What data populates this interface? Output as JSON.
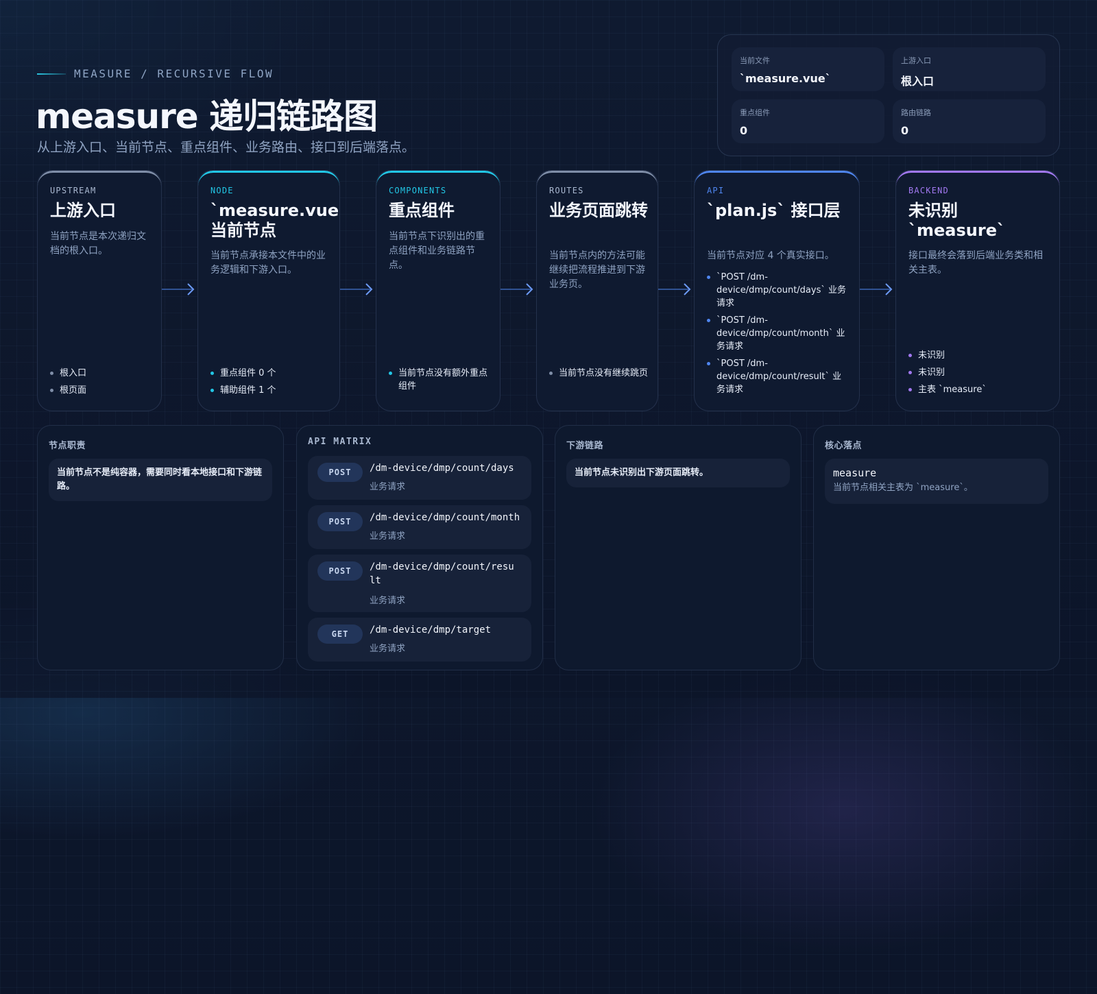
{
  "header": {
    "eyebrow": "MEASURE / RECURSIVE FLOW",
    "title": "measure 递归链路图",
    "subtitle": "从上游入口、当前节点、重点组件、业务路由、接口到后端落点。"
  },
  "stats": [
    {
      "label": "当前文件",
      "value": "`measure.vue`"
    },
    {
      "label": "上游入口",
      "value": "根入口"
    },
    {
      "label": "重点组件",
      "value": "0"
    },
    {
      "label": "路由链路",
      "value": "0"
    }
  ],
  "flow": [
    {
      "kicker": "UPSTREAM",
      "title": "上游入口",
      "desc": "当前节点是本次递归文档的根入口。",
      "items": [
        "根入口",
        "根页面"
      ],
      "color": "#7f8ea8"
    },
    {
      "kicker": "NODE",
      "title": "`measure.vue` 当前节点",
      "desc": "当前节点承接本文件中的业务逻辑和下游入口。",
      "items": [
        "重点组件 0 个",
        "辅助组件 1 个"
      ],
      "color": "#22c7e6"
    },
    {
      "kicker": "COMPONENTS",
      "title": "重点组件",
      "desc": "当前节点下识别出的重点组件和业务链路节点。",
      "items": [
        "当前节点没有额外重点组件"
      ],
      "color": "#22c7e6"
    },
    {
      "kicker": "ROUTES",
      "title": "业务页面跳转",
      "desc": "当前节点内的方法可能继续把流程推进到下游业务页。",
      "items": [
        "当前节点没有继续跳页"
      ],
      "color": "#7f8ea8"
    },
    {
      "kicker": "API",
      "title": "`plan.js` 接口层",
      "desc": "当前节点对应 4 个真实接口。",
      "items": [
        "`POST /dm-device/dmp/count/days` 业务请求",
        "`POST /dm-device/dmp/count/month` 业务请求",
        "`POST /dm-device/dmp/count/result` 业务请求"
      ],
      "color": "#4f86f0"
    },
    {
      "kicker": "BACKEND",
      "title": "未识别 `measure`",
      "desc": "接口最终会落到后端业务类和相关主表。",
      "items": [
        "未识别",
        "未识别",
        "主表 `measure`"
      ],
      "color": "#a178f0"
    }
  ],
  "panels": {
    "duty": {
      "title": "节点职责",
      "note": "当前节点不是纯容器，需要同时看本地接口和下游链路。"
    },
    "api": {
      "title": "API MATRIX",
      "rows": [
        {
          "method": "POST",
          "path": "/dm-device/dmp/count/days",
          "desc": "业务请求"
        },
        {
          "method": "POST",
          "path": "/dm-device/dmp/count/month",
          "desc": "业务请求"
        },
        {
          "method": "POST",
          "path": "/dm-device/dmp/count/result",
          "desc": "业务请求"
        },
        {
          "method": "GET",
          "path": "/dm-device/dmp/target",
          "desc": "业务请求"
        }
      ]
    },
    "downstream": {
      "title": "下游链路",
      "note": "当前节点未识别出下游页面跳转。"
    },
    "core": {
      "title": "核心落点",
      "name": "measure",
      "desc": "当前节点相关主表为 `measure`。"
    }
  },
  "colors": {
    "accent_cyan": "#22c7e6",
    "accent_blue": "#4f86f0",
    "accent_purple": "#a178f0",
    "muted": "#7f8ea8"
  }
}
